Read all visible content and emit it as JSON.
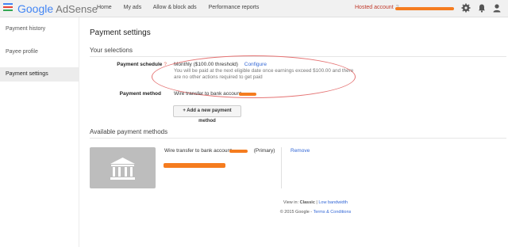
{
  "app": {
    "logo_google": "Google",
    "logo_product": "AdSense"
  },
  "nav": {
    "items": [
      "Home",
      "My ads",
      "Allow & block ads",
      "Performance reports"
    ],
    "hosted_account": "Hosted account",
    "hosted_help": "?"
  },
  "icons": {
    "settings": "gear-icon",
    "notifications": "bell-icon",
    "account": "account-avatar-icon",
    "bank": "bank-icon"
  },
  "sidebar": {
    "items": [
      {
        "label": "Payment history"
      },
      {
        "label": "Payee profile"
      },
      {
        "label": "Payment settings"
      }
    ]
  },
  "main": {
    "title": "Payment settings",
    "selections_heading": "Your selections",
    "schedule_label": "Payment schedule",
    "schedule_help": "?",
    "schedule_value": "Monthly ($100.00 threshold)",
    "configure_link": "Configure",
    "schedule_desc": "You will be paid at the next eligible date once earnings exceed $100.00 and there are no other actions required to get paid",
    "method_label": "Payment method",
    "method_value": "Wire transfer to bank account",
    "add_method_button": "+ Add a new payment method",
    "available_heading": "Available payment methods",
    "available_method": "Wire transfer to bank account",
    "primary_tag": "(Primary)",
    "remove_link": "Remove"
  },
  "footer": {
    "view_in": "View in:",
    "classic": "Classic",
    "separator": "|",
    "low_bandwidth": "Low bandwidth",
    "copyright": "© 2015 Google -",
    "terms": "Terms & Conditions"
  },
  "colors": {
    "redaction": "#f57c1f",
    "annotation_oval": "#e57373",
    "link": "#3367d6",
    "hosted_account": "#c0392b"
  }
}
